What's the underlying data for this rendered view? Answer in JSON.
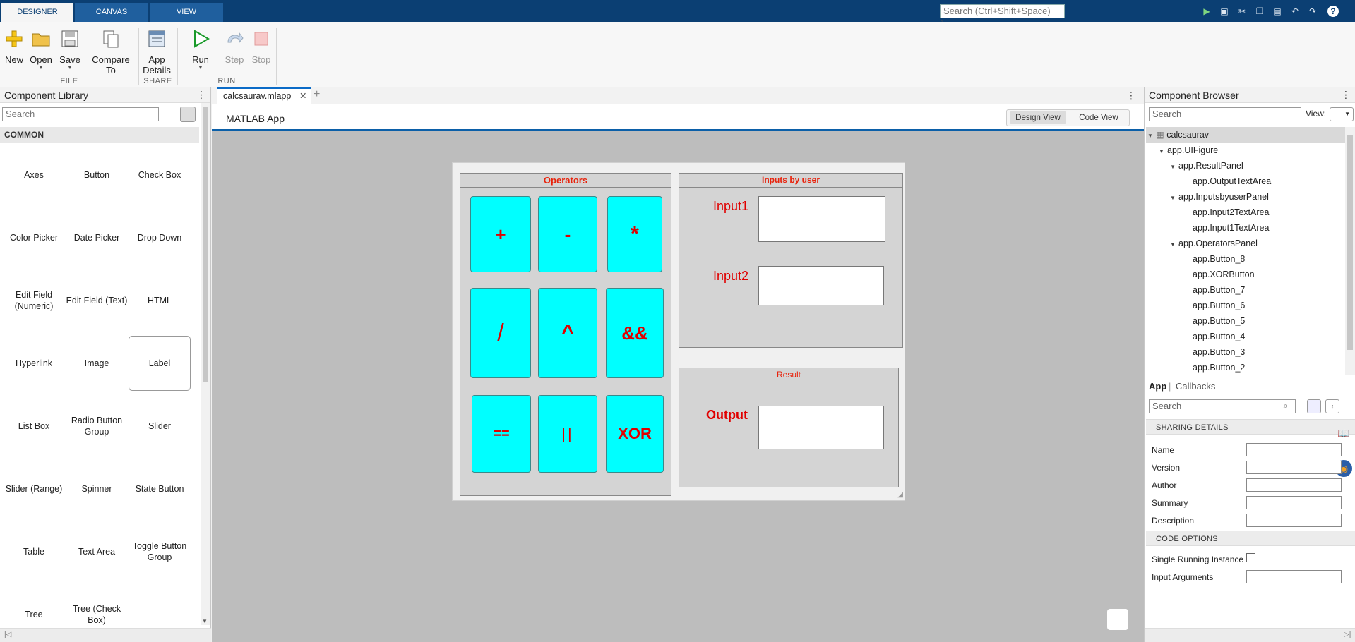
{
  "toptabs": [
    "DESIGNER",
    "CANVAS",
    "VIEW"
  ],
  "global_search": {
    "placeholder": "Search (Ctrl+Shift+Space)"
  },
  "ribbon": {
    "new": "New",
    "open": "Open",
    "save": "Save",
    "compare": "Compare To",
    "app_details_1": "App",
    "app_details_2": "Details",
    "run": "Run",
    "step": "Step",
    "stop": "Stop",
    "group_file": "FILE",
    "group_share": "SHARE",
    "group_run": "RUN"
  },
  "left_panel": {
    "title": "Component Library",
    "search_placeholder": "Search",
    "section": "COMMON",
    "components": [
      "Axes",
      "Button",
      "Check Box",
      "Color Picker",
      "Date Picker",
      "Drop Down",
      "Edit Field (Numeric)",
      "Edit Field (Text)",
      "HTML",
      "Hyperlink",
      "Image",
      "Label",
      "List Box",
      "Radio Button Group",
      "Slider",
      "Slider (Range)",
      "Spinner",
      "State Button",
      "Table",
      "Text Area",
      "Toggle Button Group",
      "Tree",
      "Tree (Check Box)"
    ],
    "selected_component": "Label"
  },
  "document": {
    "tab": "calcsaurav.mlapp",
    "app_title": "MATLAB App",
    "design_view": "Design View",
    "code_view": "Code View"
  },
  "app": {
    "operators_title": "Operators",
    "inputs_title": "Inputs by user",
    "result_title": "Result",
    "buttons": [
      "+",
      "-",
      "*",
      "/",
      "^",
      "&&",
      "==",
      "||",
      "XOR"
    ],
    "input1_label": "Input1",
    "input2_label": "Input2",
    "output_label": "Output",
    "button_color": "#00ffff",
    "label_color": "#e00000"
  },
  "right_panel": {
    "title": "Component Browser",
    "search_placeholder": "Search",
    "view_label": "View:",
    "tree": [
      "calcsaurav",
      "app.UIFigure",
      "app.ResultPanel",
      "app.OutputTextArea",
      "app.InputsbyuserPanel",
      "app.Input2TextArea",
      "app.Input1TextArea",
      "app.OperatorsPanel",
      "app.Button_8",
      "app.XORButton",
      "app.Button_7",
      "app.Button_6",
      "app.Button_5",
      "app.Button_4",
      "app.Button_3",
      "app.Button_2"
    ],
    "tab_app": "App",
    "tab_callbacks": "Callbacks",
    "inspector_search_placeholder": "Search",
    "section_sharing": "SHARING DETAILS",
    "props_sharing": [
      "Name",
      "Version",
      "Author",
      "Summary",
      "Description"
    ],
    "section_code": "CODE OPTIONS",
    "prop_single": "Single Running Instance",
    "prop_input_args": "Input Arguments"
  }
}
